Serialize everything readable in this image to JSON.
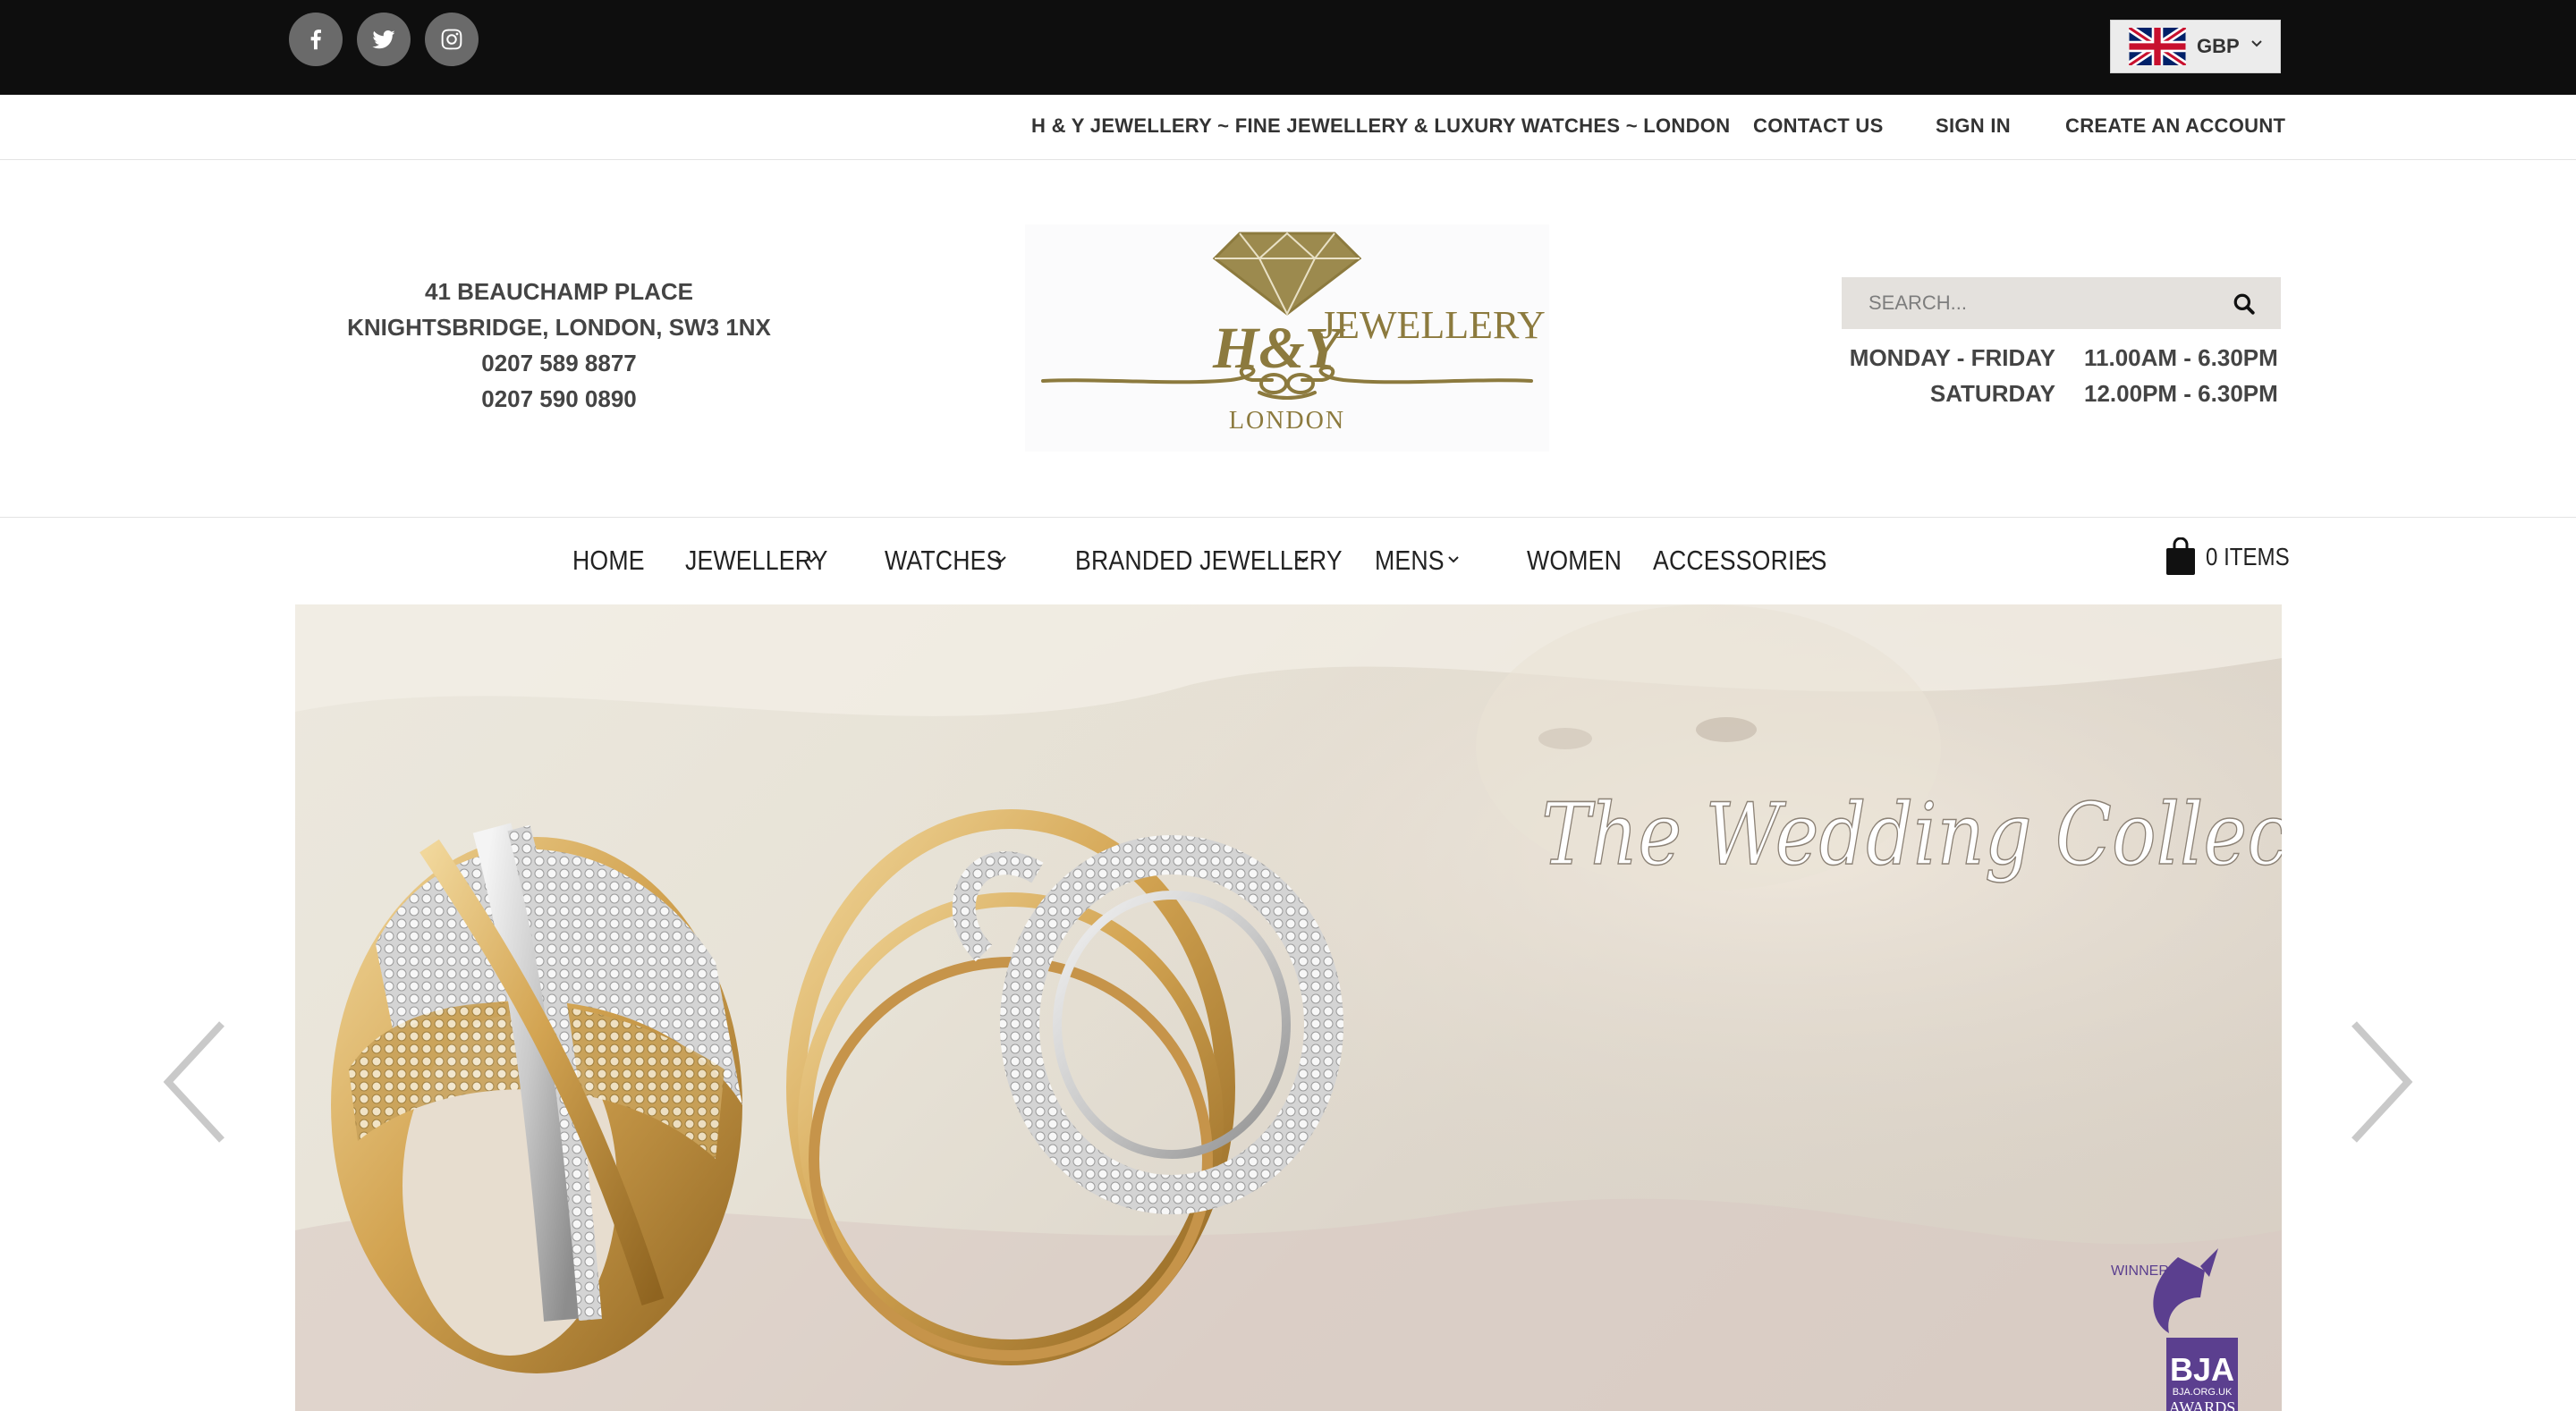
{
  "topbar": {
    "social": [
      {
        "name": "facebook",
        "icon": "facebook-icon"
      },
      {
        "name": "twitter",
        "icon": "twitter-icon"
      },
      {
        "name": "instagram",
        "icon": "instagram-icon"
      }
    ],
    "currency": {
      "flag": "uk-flag-icon",
      "label": "GBP"
    }
  },
  "secnav": {
    "tagline": "H & Y JEWELLERY ~ FINE JEWELLERY & LUXURY WATCHES ~ LONDON",
    "contact": "CONTACT US",
    "signin": "SIGN IN",
    "create": "CREATE AN ACCOUNT"
  },
  "address": {
    "line1": "41 BEAUCHAMP PLACE",
    "line2": "KNIGHTSBRIDGE, LONDON, SW3 1NX",
    "phone1": "0207 589 8877",
    "phone2": "0207 590 0890"
  },
  "logo": {
    "brand_left": "H&Y",
    "brand_right": "JEWELLERY",
    "city": "LONDON"
  },
  "search": {
    "placeholder": "SEARCH..."
  },
  "hours": [
    {
      "day": "MONDAY - FRIDAY",
      "time": "11.00AM - 6.30PM"
    },
    {
      "day": "SATURDAY",
      "time": "12.00PM - 6.30PM"
    }
  ],
  "mainnav": {
    "items": [
      {
        "label": "HOME",
        "dropdown": false
      },
      {
        "label": "JEWELLERY",
        "dropdown": true
      },
      {
        "label": "WATCHES",
        "dropdown": true
      },
      {
        "label": "BRANDED JEWELLERY",
        "dropdown": true
      },
      {
        "label": "MENS",
        "dropdown": true
      },
      {
        "label": "WOMEN",
        "dropdown": false
      },
      {
        "label": "ACCESSORIES",
        "dropdown": true
      }
    ],
    "cart": {
      "label": "0 ITEMS"
    }
  },
  "hero": {
    "caption": "The Wedding Collection",
    "badge_winner": "WINNER",
    "badge_org": "BJA",
    "badge_url": "BJA.ORG.UK",
    "badge_bottom": "AWARDS"
  },
  "colors": {
    "topbar": "#0e0e0e",
    "gold": "#8c7a3e",
    "text": "#333333",
    "search_bg": "#e4e1dd",
    "badge_purple": "#5b3f8f"
  }
}
